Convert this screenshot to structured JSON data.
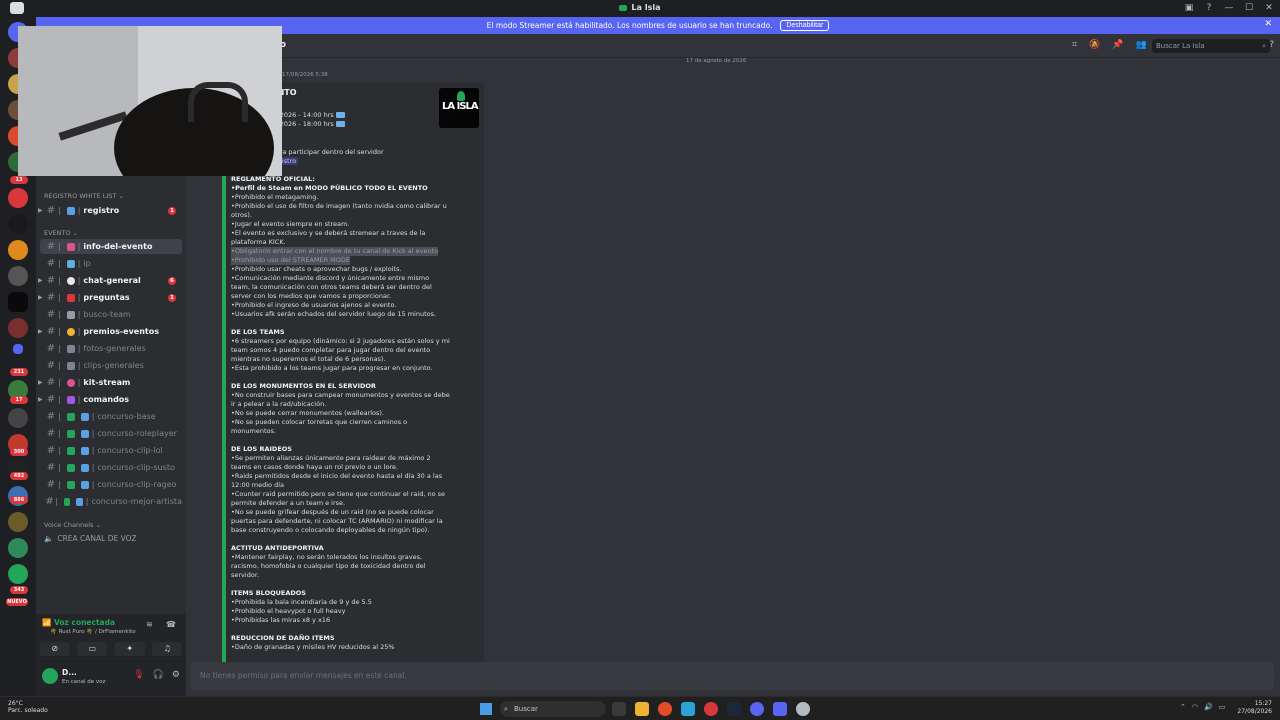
{
  "window": {
    "title": "La Isla",
    "minimize": "—",
    "maximize": "☐",
    "close": "✕"
  },
  "banner": {
    "text": "El modo Streamer está habilitado. Los nombres de usuario se han truncado.",
    "button": "Deshabilitar"
  },
  "rail_badges": [
    "13",
    "231",
    "17",
    "300",
    "492",
    "886",
    "343",
    "NUEVO"
  ],
  "sidebar": {
    "cat_whitelist": "REGISTRO WHITE LIST ⌄",
    "cat_evento": "EVENTO ⌄",
    "cat_voice": "Voice Channels ⌄",
    "voice_channel": "CREA CANAL DE VOZ",
    "channels": [
      {
        "name": "registro",
        "unread": "1"
      },
      {
        "name": "info-del-evento"
      },
      {
        "name": "ip"
      },
      {
        "name": "chat-general",
        "unread": "6"
      },
      {
        "name": "preguntas",
        "unread": "1"
      },
      {
        "name": "busco-team"
      },
      {
        "name": "premios-eventos"
      },
      {
        "name": "fotos-generales"
      },
      {
        "name": "clips-generales"
      },
      {
        "name": "kit-stream"
      },
      {
        "name": "comandos"
      },
      {
        "name": "concurso-base"
      },
      {
        "name": "concurso-roleplayer"
      },
      {
        "name": "concurso-clip-lol"
      },
      {
        "name": "concurso-clip-susto"
      },
      {
        "name": "concurso-clip-rageo"
      },
      {
        "name": "concurso-mejor-artista"
      }
    ]
  },
  "voice": {
    "status": "Voz conectada",
    "sub": "🌴 Rust Puro 🌴 / DrFlamenkito"
  },
  "user": {
    "name": "D...",
    "status": "En canal de voz"
  },
  "header": {
    "channel": "to",
    "search_placeholder": "Buscar La Isla"
  },
  "date_divider": "17 de agosto de 2026",
  "msg_time": "17/08/2026 5:38",
  "embed": {
    "title": "N DEL EVENTO",
    "logo": "LA ISLA",
    "dates": [
      "' de Agosto de 2026 - 14:00 hrs",
      "' de Agosto de 2026 - 18:00 hrs"
    ],
    "whitelist_line": "n White List para participar dentro del servidor",
    "channel_line_prefix": "nal",
    "channel_mention": "# | 💎 | registro",
    "sections": [
      {
        "heading": "REGLAMENTO OFICIAL:",
        "lines": [
          "•Perfil de Steam en MODO PÚBLICO TODO EL EVENTO",
          "•Prohibido el metagaming.",
          "•Prohibido el uso de filtro de imagen (tanto nvidia como calibrar u",
          "otros).",
          "•Jugar el evento siempre en stream.",
          "•El evento es exclusivo y se deberá stremear a traves de la",
          "plataforma KICK.",
          "•Obligatorio entrar con el nombre de tu canal de Kick al evento",
          "•Prohibido uso del STREAMER MODE",
          "•Prohibido usar cheats o aprovechar bugs / exploits.",
          "•Comunicación mediante discord y únicamente entre mismo",
          "team, la comunicación con otros teams deberá ser dentro del",
          "server con los medios que vamos a proporcionar.",
          "•Prohibido el ingreso de usuarios ajenos al evento.",
          "•Usuarios afk serán echados del servidor luego de 15 minutos."
        ]
      },
      {
        "heading": "DE LOS TEAMS",
        "lines": [
          "•6 streamers por equipo (dinámico: si 2 jugadores están solos y mi",
          "team somos 4 puedo completar para jugar dentro del evento",
          "mientras no superemos el total de 6 personas).",
          "•Esta prohibido a los teams jugar para progresar en conjunto."
        ]
      },
      {
        "heading": "DE LOS MONUMENTOS EN EL SERVIDOR",
        "lines": [
          "•No construir bases para campear monumentos y eventos se debe",
          "ir a pelear a la rad/ubicación.",
          "•No se puede cerrar monumentos (wallearlos).",
          "•No se pueden colocar torretas que cierren caminos o",
          "monumentos."
        ]
      },
      {
        "heading": "DE LOS RAIDEOS",
        "lines": [
          "•Se permiten alianzas únicamente para raidear de máximo 2",
          "teams en casos donde haya un rol previo o un lore.",
          "•Raids permitidos desde el inicio del evento hasta el día 30 a las",
          "12:00 medio día",
          "•Counter raid permitido pero se tiene que continuar el raid, no se",
          "permite defender a un team e irse.",
          "•No se puede grifear después de un raid (no se puede colocar",
          "puertas para defenderte, ni colocar TC (ARMARIO) ni modificar la",
          "base construyendo o colocando deployables de ningún tipo)."
        ]
      },
      {
        "heading": "ACTITUD ANTIDEPORTIVA",
        "lines": [
          "•Mantener fairplay, no serán tolerados los insultos graves,",
          "racismo, homofobia o cualquier tipo de toxicidad dentro del",
          "servidor."
        ]
      },
      {
        "heading": "ITEMS BLOQUEADOS",
        "lines": [
          "•Prohibida la bala incendiaria de 9 y de 5.5",
          "•Prohibido el heavypot o full heavy",
          "•Prohibidas las miras x8 y x16"
        ]
      },
      {
        "heading": "REDUCCION DE DAÑO ITEMS",
        "lines": [
          "•Daño de granadas y misiles HV reducidos al 25%"
        ]
      }
    ]
  },
  "composer": {
    "text": "No tienes permiso para enviar mensajes en este canal."
  },
  "taskbar": {
    "temp": "26°C",
    "weather": "Parc. soleado",
    "search": "Buscar",
    "time": "15:27",
    "date": "27/08/2026"
  },
  "colors": {
    "accent": "#5865f2",
    "online": "#23a55a",
    "danger": "#da373c",
    "embed_bar": "#23a55a"
  }
}
